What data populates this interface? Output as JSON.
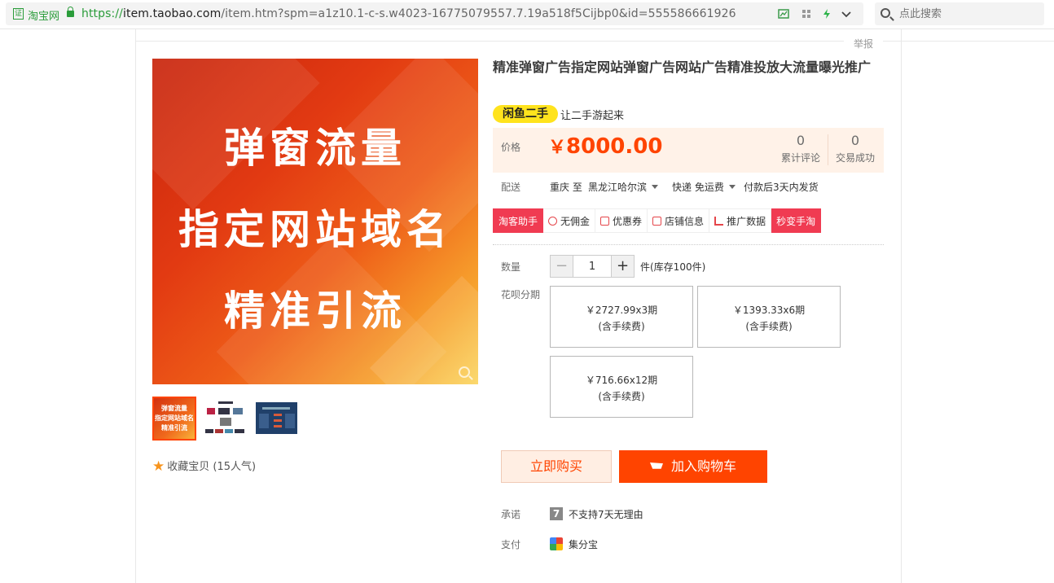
{
  "browser": {
    "cert_label": "淘宝网",
    "cert_icon": "证",
    "url_proto": "https://",
    "url_host": "item.taobao.com",
    "url_rest": "/item.htm?spm=a1z10.1-c-s.w4023-16775079557.7.19a518f5Cijbp0&id=555586661926",
    "search_placeholder": "点此搜索"
  },
  "report": "举报",
  "gallery": {
    "banner_lines": [
      "弹窗流量",
      "指定网站域名",
      "精准引流"
    ],
    "thumb1_lines": [
      "弹窗流量",
      "指定网站域名",
      "精准引流"
    ],
    "collect": "收藏宝贝 (15人气)"
  },
  "item": {
    "title": "精准弹窗广告指定网站弹窗广告网站广告精准投放大流量曝光推广",
    "xianyu_badge": "闲鱼二手",
    "xianyu_tagline": "让二手游起来",
    "price_label": "价格",
    "currency": "￥",
    "price": "8000.00",
    "reviews_count": "0",
    "reviews_label": "累计评论",
    "deals_count": "0",
    "deals_label": "交易成功"
  },
  "shipping": {
    "label": "配送",
    "from": "重庆 至",
    "to": "黑龙江哈尔滨",
    "method": "快递 免运费",
    "eta": "付款后3天内发货"
  },
  "tools": [
    "淘客助手",
    "无佣金",
    "优惠券",
    "店铺信息",
    "推广数据",
    "秒变手淘"
  ],
  "quantity": {
    "label": "数量",
    "value": "1",
    "minus": "−",
    "plus": "+",
    "stock": "件(库存100件)"
  },
  "huabei": {
    "label": "花呗分期",
    "plans": [
      {
        "price": "￥2727.99x3期",
        "note": "(含手续费)"
      },
      {
        "price": "￥1393.33x6期",
        "note": "(含手续费)"
      },
      {
        "price": "￥716.66x12期",
        "note": "(含手续费)"
      }
    ]
  },
  "actions": {
    "buy_now": "立即购买",
    "add_cart": "加入购物车"
  },
  "promise": {
    "label": "承诺",
    "icon": "7",
    "text": "不支持7天无理由"
  },
  "payment": {
    "label": "支付",
    "text": "集分宝"
  },
  "colors": {
    "accent": "#ff4400",
    "tool_red": "#f03b52",
    "xianyu": "#ffe31d"
  }
}
